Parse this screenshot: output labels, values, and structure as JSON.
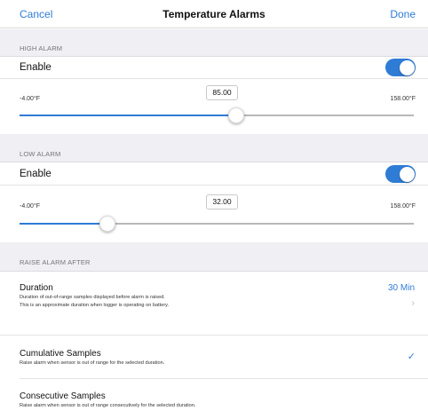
{
  "navbar": {
    "cancel_label": "Cancel",
    "title": "Temperature Alarms",
    "done_label": "Done"
  },
  "high_alarm": {
    "header": "HIGH ALARM",
    "enable_label": "Enable",
    "enabled": true,
    "min_label": "-4.00°F",
    "max_label": "158.00°F",
    "value": "85.00",
    "min": -4.0,
    "max": 158.0,
    "current": 85.0
  },
  "low_alarm": {
    "header": "LOW ALARM",
    "enable_label": "Enable",
    "enabled": true,
    "min_label": "-4.00°F",
    "max_label": "158.00°F",
    "value": "32.00",
    "min": -4.0,
    "max": 158.0,
    "current": 32.0
  },
  "raise_alarm": {
    "header": "RAISE ALARM AFTER",
    "duration": {
      "title": "Duration",
      "desc_line1": "Duration of out-of-range samples displayed before alarm is raised.",
      "desc_line2": "This is an approximate duration when logger is operating on battery.",
      "value": "30 Min",
      "chevron": "›"
    },
    "options": [
      {
        "title": "Cumulative Samples",
        "desc": "Raise alarm when sensor is out of range for the selected duration.",
        "selected": true
      },
      {
        "title": "Consecutive Samples",
        "desc": "Raise alarm when sensor is out of range consecutively for the selected duration.",
        "selected": false
      }
    ]
  },
  "icons": {
    "checkmark": "✓"
  },
  "colors": {
    "accent": "#2f7cd6",
    "section_bg": "#efeff4"
  }
}
